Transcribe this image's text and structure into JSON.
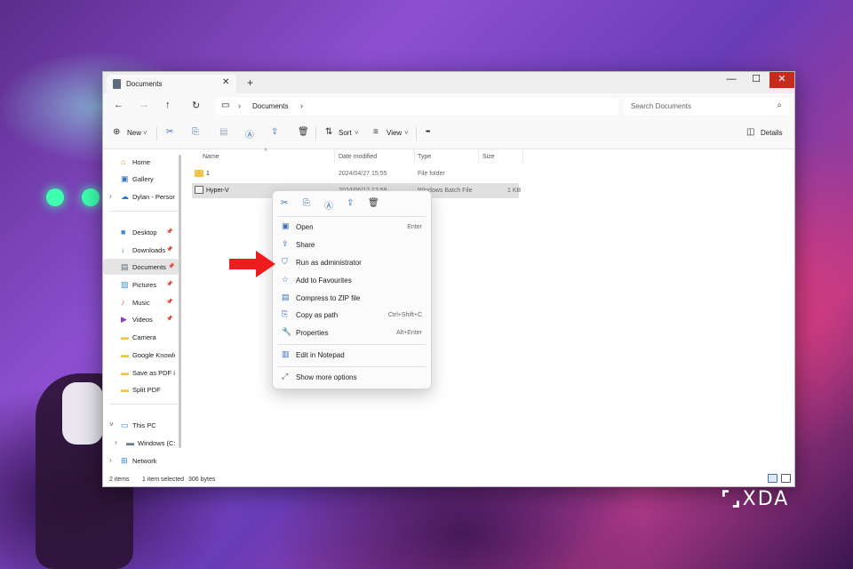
{
  "window": {
    "tab_title": "Documents",
    "tab_close": "✕",
    "tab_add": "+",
    "controls": {
      "minimize": "—",
      "maximize": "☐",
      "close": "✕"
    }
  },
  "navbar": {
    "back": "←",
    "forward": "→",
    "up": "↑",
    "refresh": "↻",
    "breadcrumb": "Documents",
    "search_placeholder": "Search Documents"
  },
  "toolbar": {
    "new_label": "New",
    "sort_label": "Sort",
    "view_label": "View",
    "more_label": "•••",
    "details_label": "Details"
  },
  "sidebar": {
    "quick": [
      {
        "label": "Home",
        "icon": "home-icon",
        "glyph": "⌂",
        "color": "#d9822b"
      },
      {
        "label": "Gallery",
        "icon": "gallery-icon",
        "glyph": "▣",
        "color": "#3b6fb6"
      },
      {
        "label": "Dylan - Person",
        "icon": "cloud-icon",
        "glyph": "☁",
        "color": "#2b7cd3"
      }
    ],
    "pinned": [
      {
        "label": "Desktop",
        "icon": "desktop-icon",
        "glyph": "■",
        "color": "#3b8ed8"
      },
      {
        "label": "Downloads",
        "icon": "download-icon",
        "glyph": "↓",
        "color": "#2a9d5c"
      },
      {
        "label": "Documents",
        "icon": "documents-icon",
        "glyph": "▤",
        "color": "#5b6b80"
      },
      {
        "label": "Pictures",
        "icon": "pictures-icon",
        "glyph": "▨",
        "color": "#3b8ed8"
      },
      {
        "label": "Music",
        "icon": "music-icon",
        "glyph": "♪",
        "color": "#e0643a"
      },
      {
        "label": "Videos",
        "icon": "videos-icon",
        "glyph": "▶",
        "color": "#8b3fc8"
      },
      {
        "label": "Camera",
        "icon": "folder-icon",
        "glyph": "▬",
        "color": "#f4c342"
      },
      {
        "label": "Google Knowle",
        "icon": "folder-icon",
        "glyph": "▬",
        "color": "#f4c342"
      },
      {
        "label": "Save as PDF in",
        "icon": "folder-icon",
        "glyph": "▬",
        "color": "#f4c342"
      },
      {
        "label": "Split PDF",
        "icon": "folder-icon",
        "glyph": "▬",
        "color": "#f4c342"
      }
    ],
    "devices": [
      {
        "label": "This PC",
        "icon": "pc-icon",
        "glyph": "▭",
        "color": "#2b7cd3"
      },
      {
        "label": "Windows (C:",
        "icon": "drive-icon",
        "glyph": "▬",
        "color": "#6d7a8c"
      },
      {
        "label": "Network",
        "icon": "network-icon",
        "glyph": "⊞",
        "color": "#2b7cd3"
      }
    ]
  },
  "files": {
    "columns": {
      "name": "Name",
      "date": "Date modified",
      "type": "Type",
      "size": "Size"
    },
    "rows": [
      {
        "name": "1",
        "date": "2024/04/27 15:55",
        "type": "File folder",
        "size": ""
      },
      {
        "name": "Hyper-V",
        "date": "2024/06/12 12:59",
        "type": "Windows Batch File",
        "size": "1 KB"
      }
    ]
  },
  "status": {
    "items": "2 items",
    "selected": "1 item selected",
    "size": "306 bytes"
  },
  "context_menu": {
    "items": [
      {
        "label": "Open",
        "shortcut": "Enter",
        "icon": "open-icon",
        "glyph": "▣"
      },
      {
        "label": "Share",
        "shortcut": "",
        "icon": "share-icon",
        "glyph": "⇪"
      },
      {
        "label": "Run as administrator",
        "shortcut": "",
        "icon": "shield-icon",
        "glyph": "⛉"
      },
      {
        "label": "Add to Favourites",
        "shortcut": "",
        "icon": "star-icon",
        "glyph": "☆"
      },
      {
        "label": "Compress to ZIP file",
        "shortcut": "",
        "icon": "zip-icon",
        "glyph": "▤"
      },
      {
        "label": "Copy as path",
        "shortcut": "Ctrl+Shift+C",
        "icon": "path-icon",
        "glyph": "⎘"
      },
      {
        "label": "Properties",
        "shortcut": "Alt+Enter",
        "icon": "wrench-icon",
        "glyph": "🔧"
      },
      {
        "label": "Edit in Notepad",
        "shortcut": "",
        "icon": "notepad-icon",
        "glyph": "▥"
      },
      {
        "label": "Show more options",
        "shortcut": "",
        "icon": "more-options-icon",
        "glyph": "⤢"
      }
    ]
  },
  "watermark": "XDA",
  "accent_color": "#3b6fb6",
  "arrow_color": "#ee1c1c"
}
